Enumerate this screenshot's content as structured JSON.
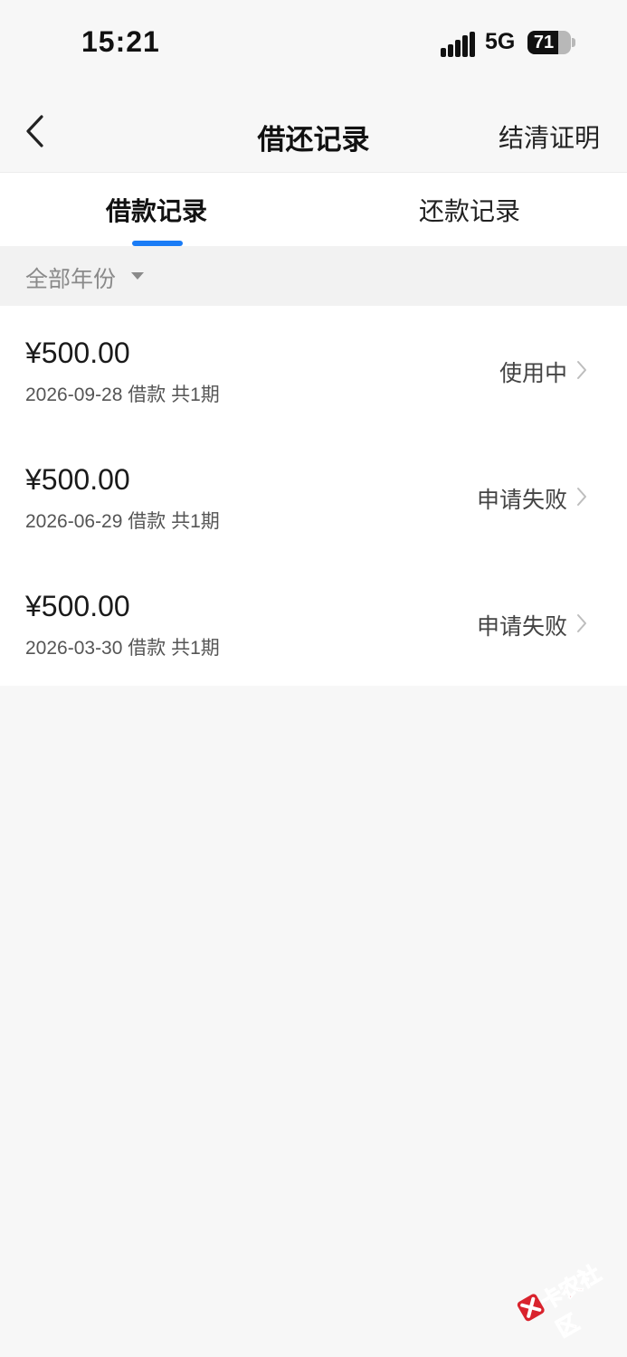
{
  "status_bar": {
    "time": "15:21",
    "network": "5G",
    "battery": "71",
    "battery_level": 0.71,
    "icons": [
      "signal-icon",
      "battery-icon"
    ]
  },
  "nav": {
    "title": "借还记录",
    "action_label": "结清证明",
    "back_icon": "chevron-left-icon"
  },
  "tabs": [
    {
      "label": "借款记录",
      "active": true
    },
    {
      "label": "还款记录",
      "active": false
    }
  ],
  "filter": {
    "label": "全部年份",
    "icon": "caret-down-icon"
  },
  "records": [
    {
      "amount": "¥500.00",
      "meta": "2026-09-28 借款 共1期",
      "status": "使用中"
    },
    {
      "amount": "¥500.00",
      "meta": "2026-06-29 借款 共1期",
      "status": "申请失败"
    },
    {
      "amount": "¥500.00",
      "meta": "2026-03-30 借款 共1期",
      "status": "申请失败"
    }
  ],
  "watermark": {
    "text": "卡农社区"
  },
  "colors": {
    "accent": "#1a7cf6",
    "page_background": "#f7f7f7",
    "watermark": "#d9232d"
  }
}
